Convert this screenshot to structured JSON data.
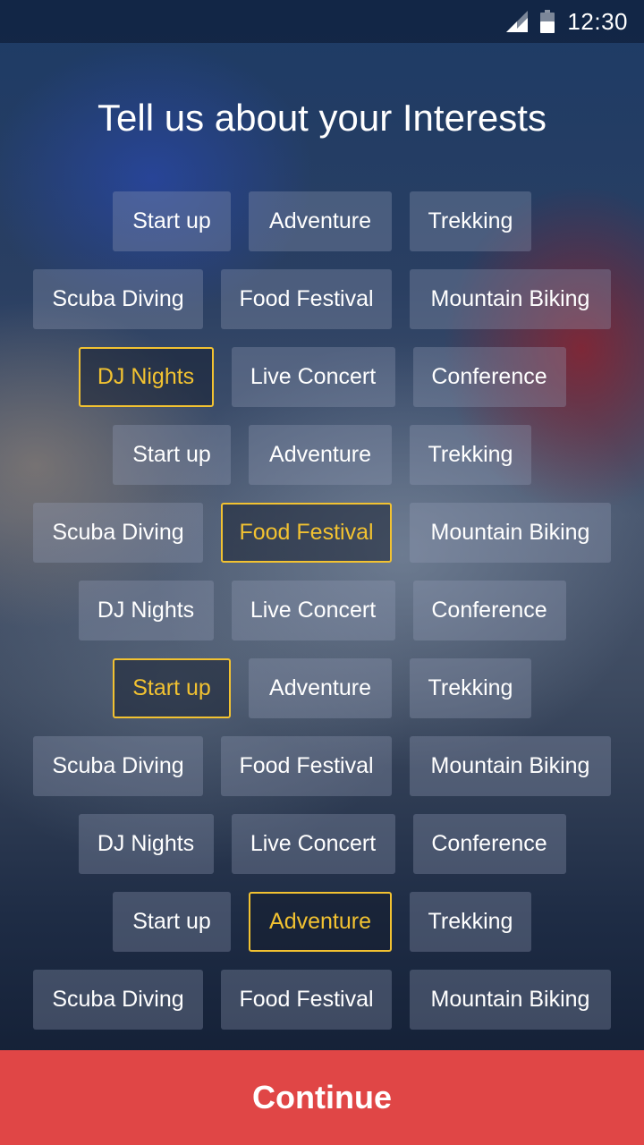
{
  "status_bar": {
    "time": "12:30",
    "icons": [
      "signal-icon",
      "battery-icon"
    ]
  },
  "title": "Tell us about your Interests",
  "colors": {
    "selected_accent": "#f2c231",
    "continue_button": "#e04646"
  },
  "rows": [
    {
      "chips": [
        {
          "label": "Start up",
          "selected": false
        },
        {
          "label": "Adventure",
          "selected": false
        },
        {
          "label": "Trekking",
          "selected": false
        }
      ]
    },
    {
      "chips": [
        {
          "label": "Scuba Diving",
          "selected": false
        },
        {
          "label": "Food Festival",
          "selected": false
        },
        {
          "label": "Mountain Biking",
          "selected": false
        }
      ]
    },
    {
      "chips": [
        {
          "label": "DJ Nights",
          "selected": true
        },
        {
          "label": "Live Concert",
          "selected": false
        },
        {
          "label": "Conference",
          "selected": false
        }
      ]
    },
    {
      "chips": [
        {
          "label": "Start up",
          "selected": false
        },
        {
          "label": "Adventure",
          "selected": false
        },
        {
          "label": "Trekking",
          "selected": false
        }
      ]
    },
    {
      "chips": [
        {
          "label": "Scuba Diving",
          "selected": false
        },
        {
          "label": "Food Festival",
          "selected": true
        },
        {
          "label": "Mountain Biking",
          "selected": false
        }
      ]
    },
    {
      "chips": [
        {
          "label": "DJ Nights",
          "selected": false
        },
        {
          "label": "Live Concert",
          "selected": false
        },
        {
          "label": "Conference",
          "selected": false
        }
      ]
    },
    {
      "chips": [
        {
          "label": "Start up",
          "selected": true
        },
        {
          "label": "Adventure",
          "selected": false
        },
        {
          "label": "Trekking",
          "selected": false
        }
      ]
    },
    {
      "chips": [
        {
          "label": "Scuba Diving",
          "selected": false
        },
        {
          "label": "Food Festival",
          "selected": false
        },
        {
          "label": "Mountain Biking",
          "selected": false
        }
      ]
    },
    {
      "chips": [
        {
          "label": "DJ Nights",
          "selected": false
        },
        {
          "label": "Live Concert",
          "selected": false
        },
        {
          "label": "Conference",
          "selected": false
        }
      ]
    },
    {
      "chips": [
        {
          "label": "Start up",
          "selected": false
        },
        {
          "label": "Adventure",
          "selected": true
        },
        {
          "label": "Trekking",
          "selected": false
        }
      ]
    },
    {
      "chips": [
        {
          "label": "Scuba Diving",
          "selected": false
        },
        {
          "label": "Food Festival",
          "selected": false
        },
        {
          "label": "Mountain Biking",
          "selected": false
        }
      ]
    }
  ],
  "continue_label": "Continue"
}
